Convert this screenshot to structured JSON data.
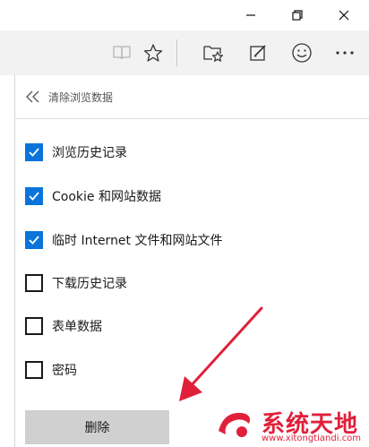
{
  "window": {
    "minimize_icon": "minimize-icon",
    "restore_icon": "restore-icon",
    "close_icon": "close-icon"
  },
  "toolbar": {
    "icons": [
      "reading-view-icon",
      "favorite-star-icon",
      "favorites-hub-icon",
      "web-note-icon",
      "feedback-smiley-icon",
      "more-icon"
    ]
  },
  "panel": {
    "title": "清除浏览数据",
    "items": [
      {
        "label": "浏览历史记录",
        "checked": true
      },
      {
        "label": "Cookie 和网站数据",
        "checked": true
      },
      {
        "label": "临时 Internet 文件和网站文件",
        "checked": true
      },
      {
        "label": "下载历史记录",
        "checked": false
      },
      {
        "label": "表单数据",
        "checked": false
      },
      {
        "label": "密码",
        "checked": false
      }
    ],
    "delete_label": "删除"
  },
  "watermark": {
    "title": "系统天地",
    "url": "www.xitongtiandi.com"
  },
  "colors": {
    "accent": "#0a74da",
    "arrow": "#e0203a",
    "toolbar_bg": "#f2f2f2",
    "button_bg": "#d0d0d0"
  }
}
